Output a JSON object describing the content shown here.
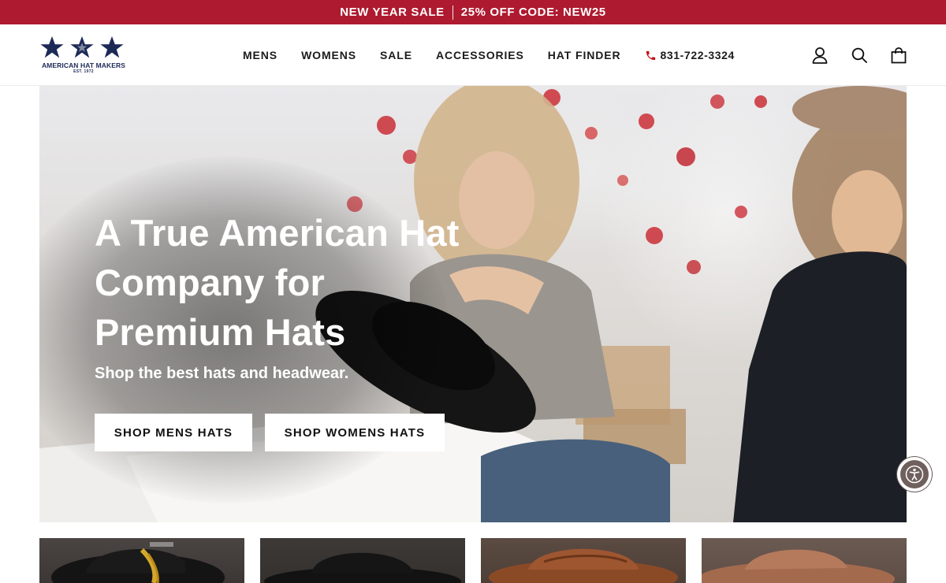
{
  "announcement": {
    "left": "NEW YEAR SALE",
    "right": "25% OFF CODE: NEW25"
  },
  "logo": {
    "name": "AMERICAN HAT MAKERS",
    "est": "EST. 1972",
    "icon": "three-stars-logo"
  },
  "nav": {
    "items": [
      "MENS",
      "WOMENS",
      "SALE",
      "ACCESSORIES",
      "HAT FINDER"
    ],
    "phone": "831-722-3324",
    "phone_icon": "phone-icon"
  },
  "header_icons": [
    "account-icon",
    "search-icon",
    "cart-icon"
  ],
  "hero": {
    "title": "A True American Hat Company for Premium Hats",
    "subtitle": "Shop the best hats and headwear.",
    "buttons": {
      "mens": "SHOP MENS HATS",
      "womens": "SHOP WOMENS HATS"
    }
  },
  "accessibility": {
    "icon": "accessibility-icon"
  },
  "product_tiles": [
    "black-hat-feather",
    "black-wide-brim-hat",
    "brown-leather-hat",
    "brown-felt-hat"
  ],
  "colors": {
    "announcement_bg": "#ae1a2f",
    "logo_navy": "#1d2a56",
    "text": "#1b1b1b",
    "button_bg": "#ffffff"
  }
}
